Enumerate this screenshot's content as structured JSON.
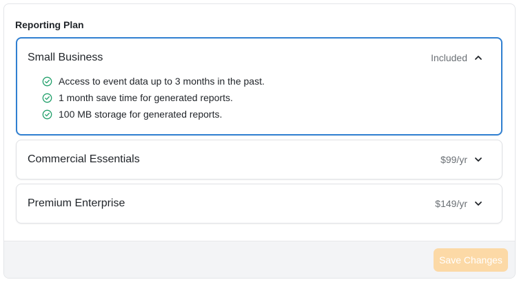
{
  "section": {
    "title": "Reporting Plan"
  },
  "plans": [
    {
      "name": "Small Business",
      "price": "Included",
      "expanded": true,
      "features": [
        "Access to event data up to 3 months in the past.",
        "1 month save time for generated reports.",
        "100 MB storage for generated reports."
      ]
    },
    {
      "name": "Commercial Essentials",
      "price": "$99/yr",
      "expanded": false
    },
    {
      "name": "Premium Enterprise",
      "price": "$149/yr",
      "expanded": false
    }
  ],
  "footer": {
    "save_label": "Save Changes",
    "save_disabled": true
  },
  "colors": {
    "accent_border": "#2f7fd1",
    "check_green": "#22a06b",
    "save_button_disabled": "#fcd9a6"
  },
  "icons": {
    "expanded": "chevron-up-icon",
    "collapsed": "chevron-down-icon",
    "feature": "check-circle-icon"
  }
}
